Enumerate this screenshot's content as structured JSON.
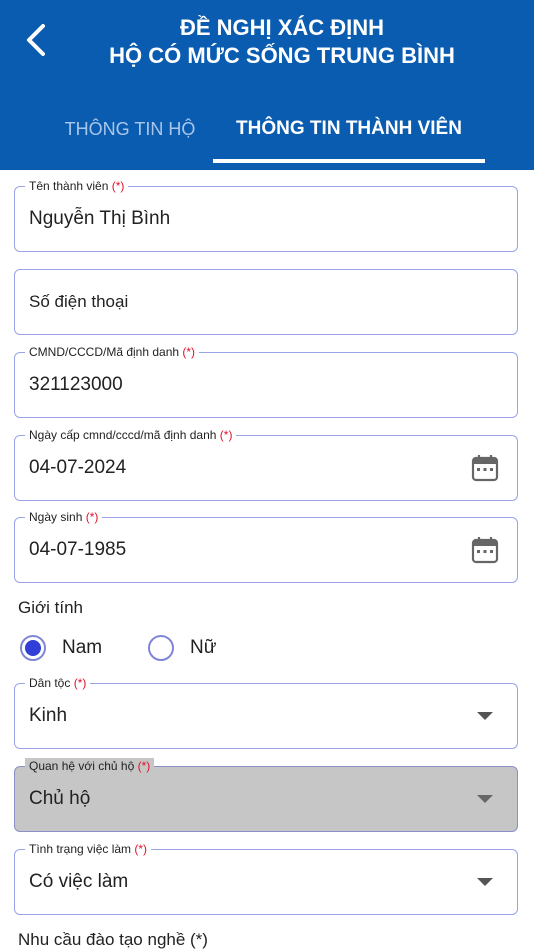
{
  "header": {
    "back_icon": "chevron-left-icon",
    "title_line1": "ĐỀ NGHỊ XÁC ĐỊNH",
    "title_line2": "HỘ CÓ MỨC SỐNG TRUNG BÌNH",
    "color": "#0a5cb0"
  },
  "tabs": [
    {
      "label": "THÔNG TIN HỘ",
      "active": false
    },
    {
      "label": "THÔNG TIN THÀNH VIÊN",
      "active": true
    }
  ],
  "form": {
    "member_name": {
      "label": "Tên thành viên",
      "required_mark": "(*)",
      "value": "Nguyễn Thị Bình"
    },
    "phone": {
      "placeholder": "Số điện thoại"
    },
    "id_number": {
      "label": "CMND/CCCD/Mã định danh",
      "required_mark": "(*)",
      "value": "321123000"
    },
    "issue_date": {
      "label": "Ngày cấp cmnd/cccd/mã định danh",
      "required_mark": "(*)",
      "value": "04-07-2024",
      "icon": "calendar-icon"
    },
    "birth_date": {
      "label": "Ngày sinh",
      "required_mark": "(*)",
      "value": "04-07-1985",
      "icon": "calendar-icon"
    },
    "gender": {
      "label": "Giới tính",
      "options": [
        "Nam",
        "Nữ"
      ],
      "selected": "Nam"
    },
    "ethnicity": {
      "label": "Dân tộc",
      "required_mark": "(*)",
      "value": "Kinh"
    },
    "relationship": {
      "label": "Quan hệ với chủ hộ",
      "required_mark": "(*)",
      "value": "Chủ hộ",
      "disabled": true
    },
    "employment": {
      "label": "Tình trạng việc làm",
      "required_mark": "(*)",
      "value": "Có việc làm"
    },
    "training_need": {
      "label": "Nhu cầu đào tạo nghề (*)"
    }
  },
  "colors": {
    "accent": "#2f3fd8",
    "required": "#e0102a",
    "border": "#9aa3e8"
  }
}
